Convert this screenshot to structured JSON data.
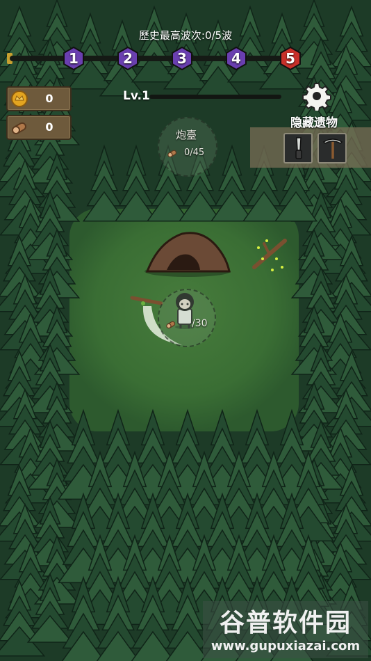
{
  "hud": {
    "wave_record": "歷史最高波次:0/5波",
    "waves": [
      {
        "label": "1",
        "color": "#6a3fb0"
      },
      {
        "label": "2",
        "color": "#6a3fb0"
      },
      {
        "label": "3",
        "color": "#6a3fb0"
      },
      {
        "label": "4",
        "color": "#6a3fb0"
      },
      {
        "label": "5",
        "color": "#c8302a"
      }
    ],
    "level": "Lv.1",
    "level_progress": 0
  },
  "resources": {
    "coins": {
      "icon": "coin-icon",
      "value": "0"
    },
    "wood": {
      "icon": "wood-log-icon",
      "value": "0"
    }
  },
  "settings": {
    "icon": "gear-icon"
  },
  "relics": {
    "title": "隐藏遗物",
    "items": [
      {
        "icon": "knife-icon"
      },
      {
        "icon": "pickaxe-icon"
      }
    ]
  },
  "turret_site": {
    "name": "炮臺",
    "cost": "0/45",
    "icon": "wood-log-icon"
  },
  "player": {
    "cost": "/30",
    "icon": "wood-log-icon"
  },
  "watermark": {
    "title": "谷普软件园",
    "url": "www.gupuxiazai.com"
  },
  "colors": {
    "grass": "#3a6e34",
    "forest": "#1e3d27",
    "tree": "#244a30",
    "tree_light": "#2f5b3a"
  }
}
